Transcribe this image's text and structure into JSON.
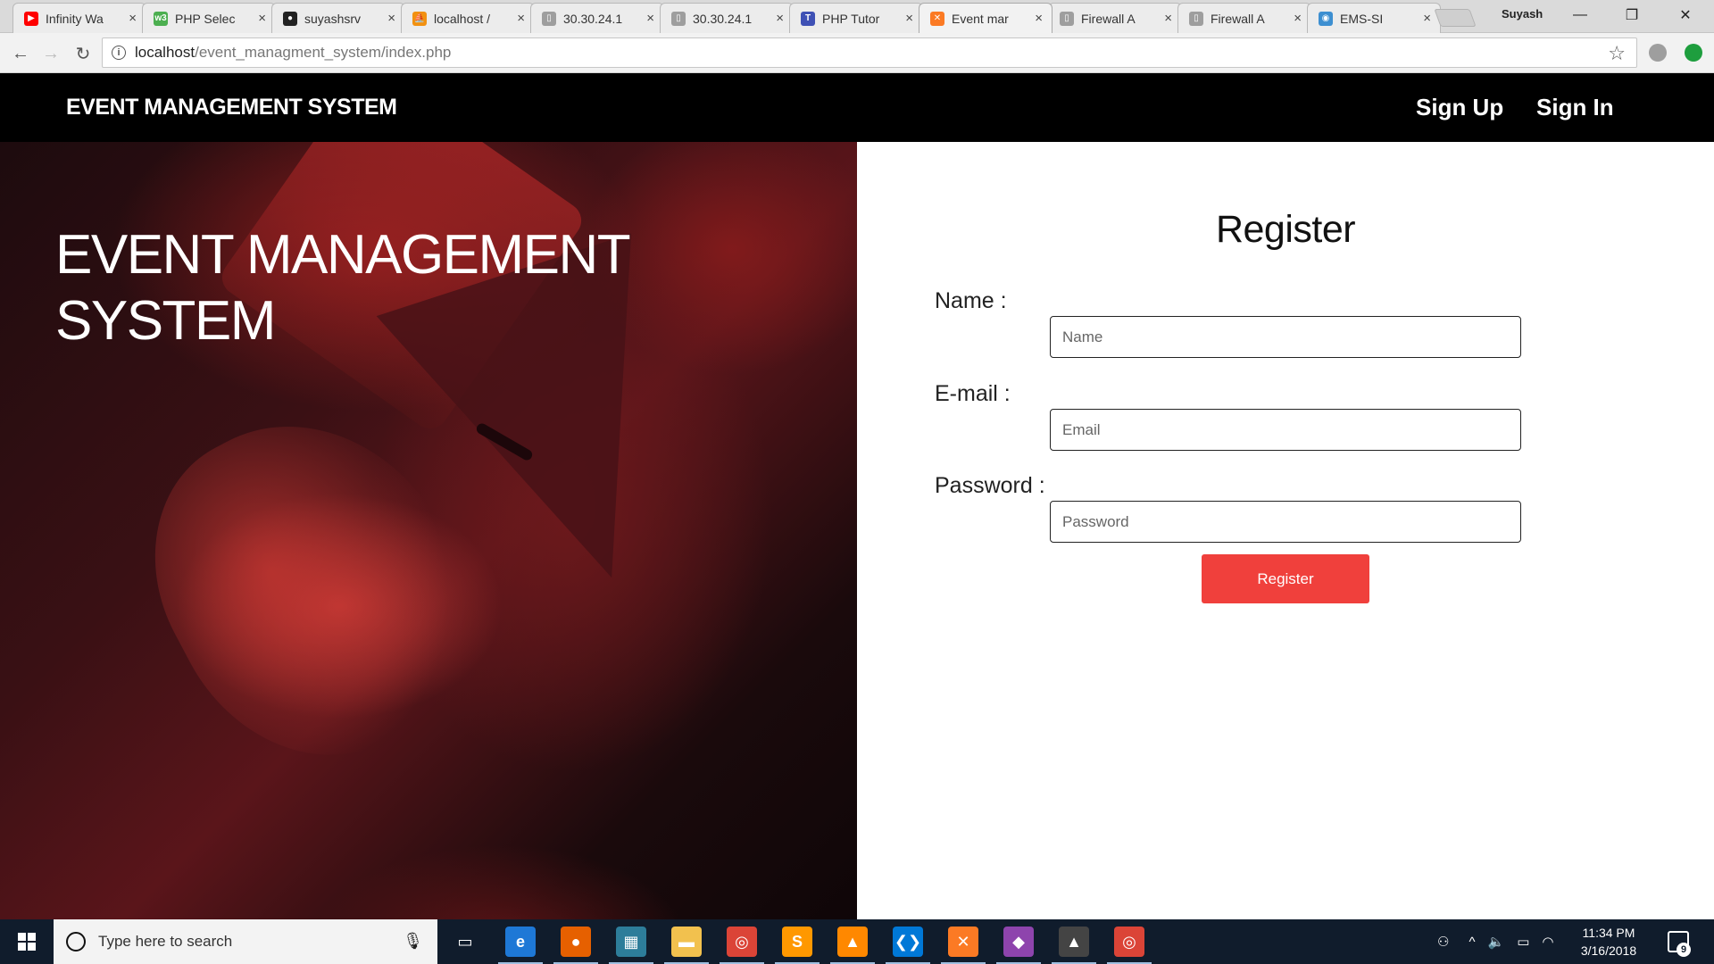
{
  "browser": {
    "tabs": [
      {
        "title": "Infinity Wa",
        "icon": "youtube-icon",
        "color": "#ff0000",
        "glyph": "▶"
      },
      {
        "title": "PHP Selec",
        "icon": "w3schools-icon",
        "color": "#4caf50",
        "glyph": "w3"
      },
      {
        "title": "suyashsrv",
        "icon": "github-icon",
        "color": "#222222",
        "glyph": "●"
      },
      {
        "title": "localhost /",
        "icon": "phpmyadmin-icon",
        "color": "#f29111",
        "glyph": "⛵"
      },
      {
        "title": "30.30.24.1",
        "icon": "page-icon",
        "color": "#9e9e9e",
        "glyph": "▯"
      },
      {
        "title": "30.30.24.1",
        "icon": "page-icon",
        "color": "#9e9e9e",
        "glyph": "▯"
      },
      {
        "title": "PHP Tutor",
        "icon": "tutorial-icon",
        "color": "#3f51b5",
        "glyph": "T"
      },
      {
        "title": "Event mar",
        "icon": "xampp-icon",
        "color": "#fb7a24",
        "glyph": "✕"
      },
      {
        "title": "Firewall A",
        "icon": "page-icon",
        "color": "#9e9e9e",
        "glyph": "▯"
      },
      {
        "title": "Firewall A",
        "icon": "page-icon",
        "color": "#9e9e9e",
        "glyph": "▯"
      },
      {
        "title": "EMS-SI",
        "icon": "drupal-icon",
        "color": "#3d8fd1",
        "glyph": "◉"
      }
    ],
    "close_glyph": "×",
    "profile_name": "Suyash",
    "window_controls": {
      "minimize": "—",
      "restore": "❐",
      "close": "✕"
    },
    "url_host": "localhost",
    "url_path": "/event_managment_system/index.php",
    "nav": {
      "back": "←",
      "forward": "→",
      "reload": "↻",
      "info": "i",
      "star": "☆"
    }
  },
  "site": {
    "brand": "EVENT MANAGEMENT SYSTEM",
    "nav_links": {
      "signup": "Sign Up",
      "signin": "Sign In"
    },
    "hero_title": "EVENT MANAGEMENT SYSTEM",
    "form": {
      "title": "Register",
      "name_label": "Name :",
      "name_placeholder": "Name",
      "email_label": "E-mail :",
      "email_placeholder": "Email",
      "password_label": "Password :",
      "password_placeholder": "Password",
      "submit_label": "Register"
    },
    "colors": {
      "accent": "#f0403c",
      "navbar": "#000000"
    }
  },
  "taskbar": {
    "search_placeholder": "Type here to search",
    "apps": [
      {
        "name": "task-view-icon",
        "glyph": "▭",
        "color": "transparent"
      },
      {
        "name": "edge-icon",
        "glyph": "e",
        "color": "#1e78d6"
      },
      {
        "name": "firefox-icon",
        "glyph": "●",
        "color": "#e66000"
      },
      {
        "name": "store-icon",
        "glyph": "▦",
        "color": "#2d7d9a"
      },
      {
        "name": "file-explorer-icon",
        "glyph": "▬",
        "color": "#f2c14e"
      },
      {
        "name": "chrome-icon",
        "glyph": "◎",
        "color": "#db4437"
      },
      {
        "name": "sublime-icon",
        "glyph": "S",
        "color": "#ff9800"
      },
      {
        "name": "vlc-icon",
        "glyph": "▲",
        "color": "#ff8800"
      },
      {
        "name": "vscode-icon",
        "glyph": "❮❯",
        "color": "#0078d7"
      },
      {
        "name": "xampp-icon",
        "glyph": "✕",
        "color": "#fb7a24"
      },
      {
        "name": "git-icon",
        "glyph": "◆",
        "color": "#8e44ad"
      },
      {
        "name": "photos-icon",
        "glyph": "▲",
        "color": "#444444"
      },
      {
        "name": "chrome-icon",
        "glyph": "◎",
        "color": "#db4437"
      }
    ],
    "time": "11:34 PM",
    "date": "3/16/2018",
    "notification_count": "9"
  }
}
